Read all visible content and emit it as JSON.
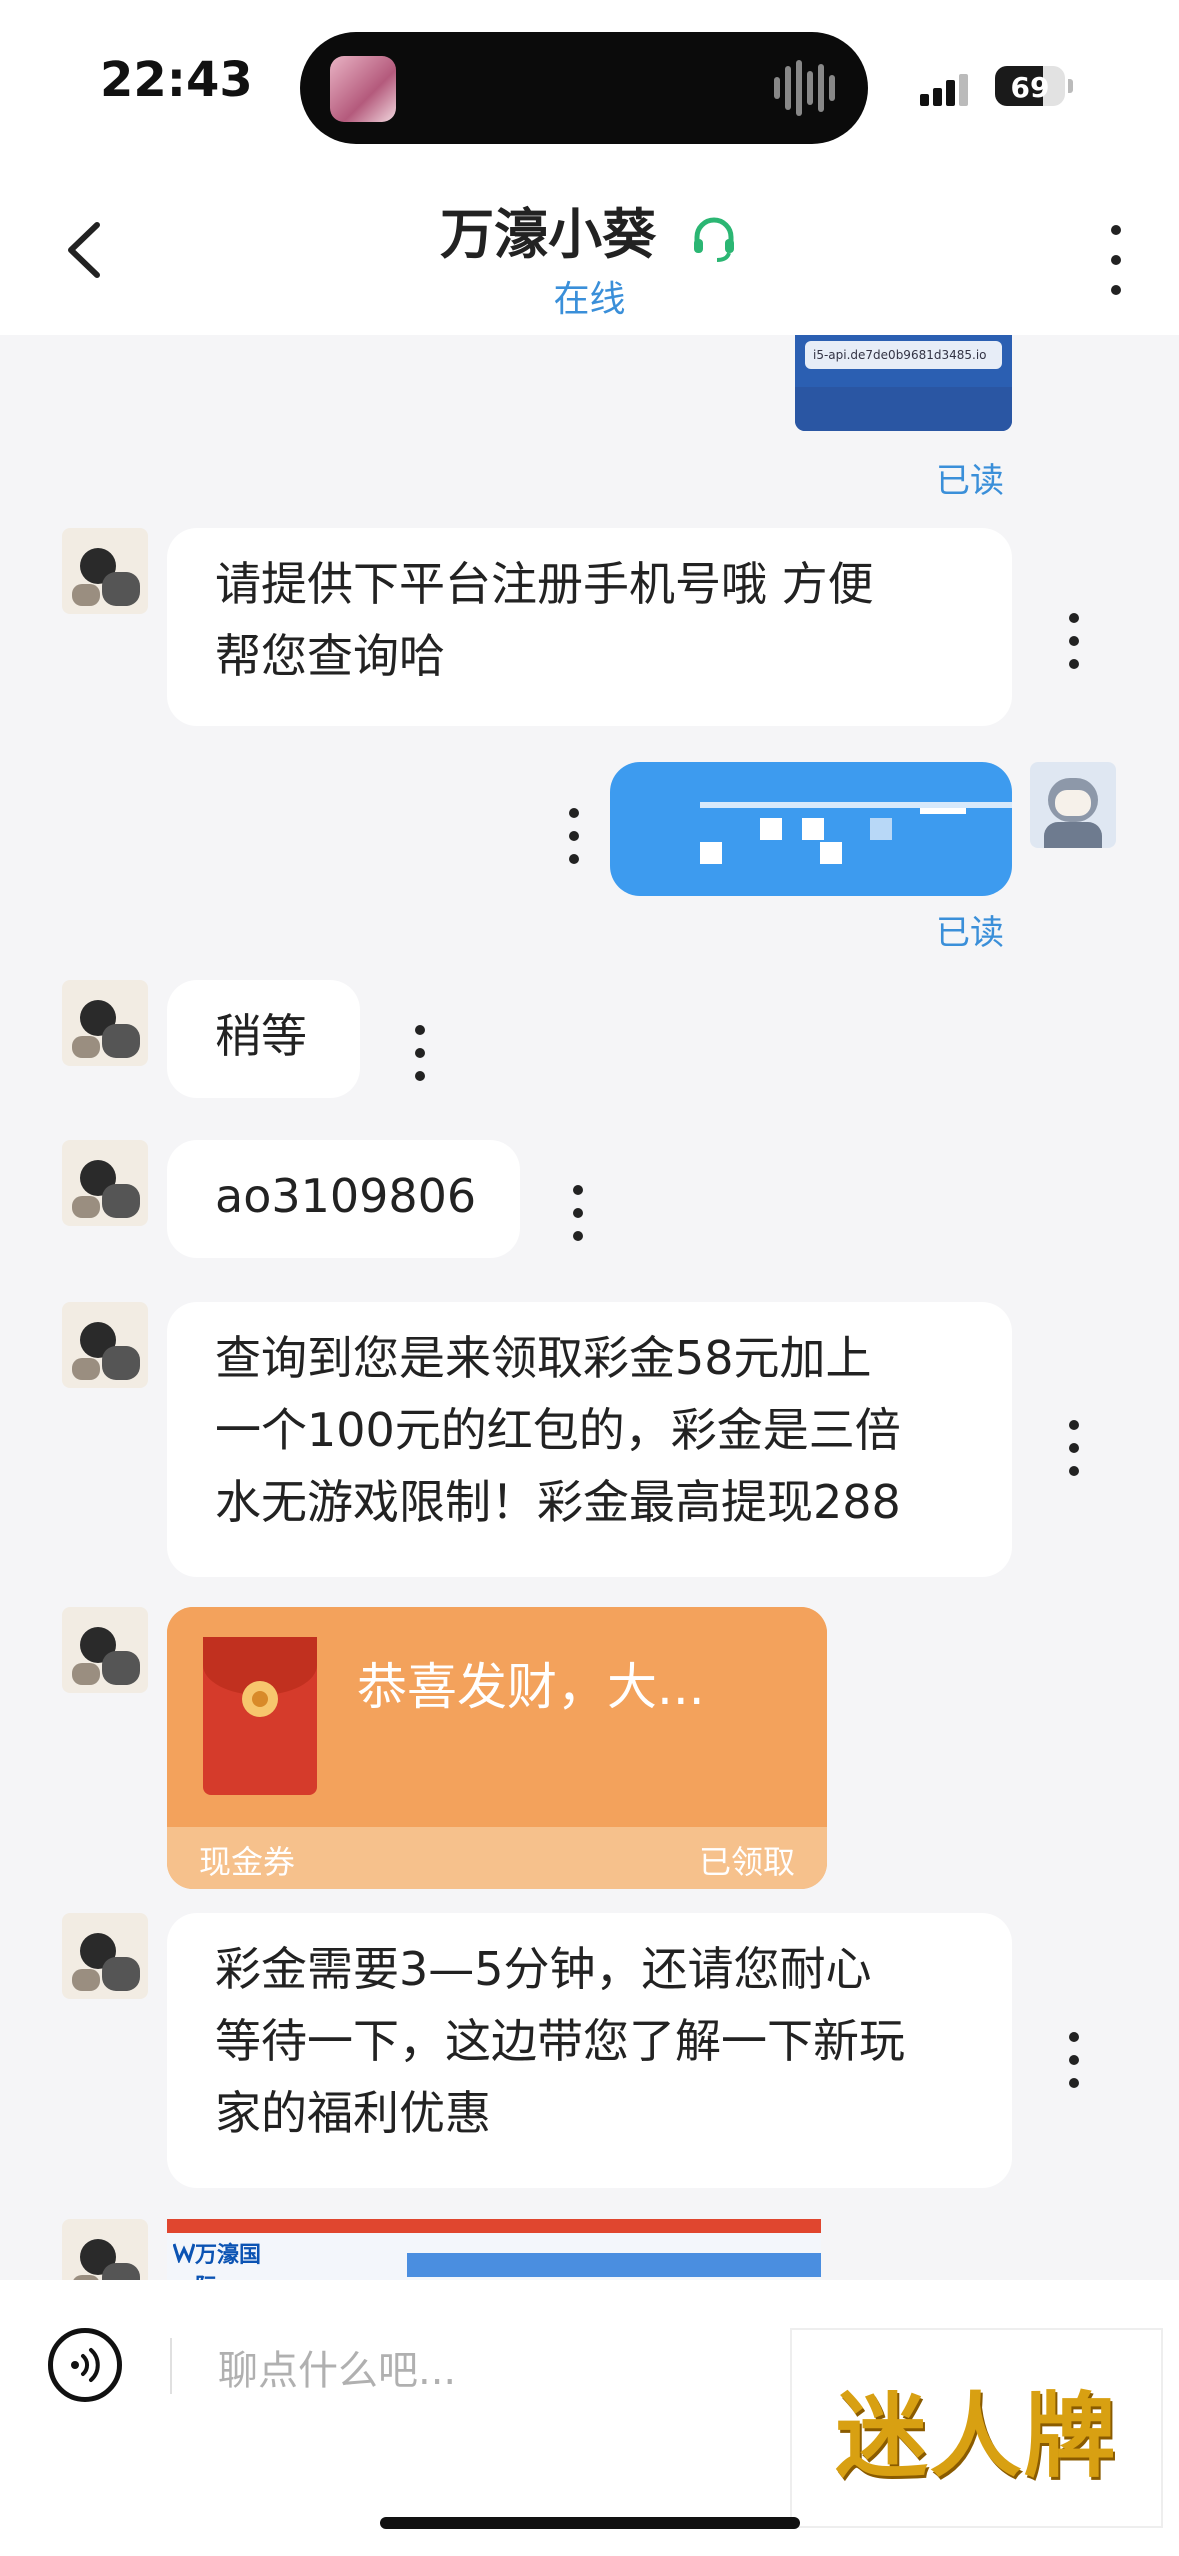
{
  "status_bar": {
    "time": "22:43",
    "battery": "69",
    "battery_level": 0.69
  },
  "header": {
    "title": "万濠小葵",
    "status": "在线"
  },
  "messages": {
    "read_label": "已读",
    "screenshot_url": "i5-api.de7de0b9681d3485.io",
    "m1": [
      "请提供下平台注册手机号哦 方便",
      "帮您查询哈"
    ],
    "m2": "稍等",
    "m3": "ao3109806",
    "m4": [
      "查询到您是来领取彩金58元加上",
      "一个100元的红包的，彩金是三倍",
      "水无游戏限制！彩金最高提现288"
    ],
    "redpacket": {
      "title": "恭喜发财，大...",
      "label": "现金券",
      "status": "已领取"
    },
    "m5": [
      "彩金需要3—5分钟，还请您耐心",
      "等待一下，这边带您了解一下新玩",
      "家的福利优惠"
    ],
    "banner_logo": "万濠国际"
  },
  "input": {
    "placeholder": "聊点什么吧..."
  },
  "watermark": "迷人牌",
  "colors": {
    "accent_blue": "#3a8fd9",
    "my_bubble": "#3d9bef",
    "redpacket": "#f3a25c",
    "online_icon": "#2bb673"
  },
  "icons": [
    "back-icon",
    "headset-icon",
    "more-icon",
    "voice-icon",
    "red-envelope-icon"
  ]
}
